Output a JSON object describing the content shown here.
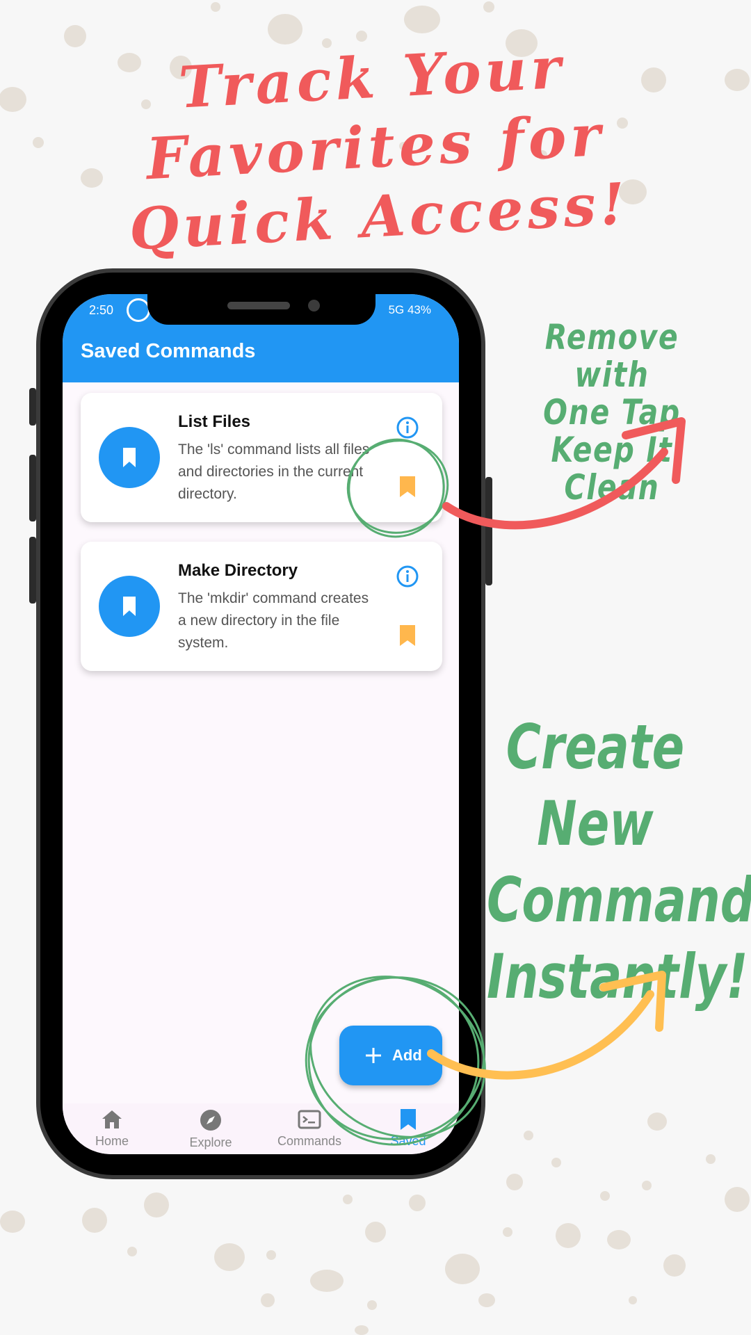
{
  "headline": {
    "line1": "Track Your",
    "line2": "Favorites for",
    "line3": "Quick Access!"
  },
  "callouts": {
    "top_line1": "Remove with",
    "top_line2": "One Tap Keep It",
    "top_line3": "Clean",
    "bottom_line1": "Create New",
    "bottom_line2": "Commands",
    "bottom_line3": "Instantly!"
  },
  "status_bar": {
    "time": "2:50",
    "right": "5G 43%"
  },
  "app_bar": {
    "title": "Saved Commands"
  },
  "cards": [
    {
      "title": "List Files",
      "description": "The 'ls' command lists all files and directories in the current directory.",
      "icon": "bookmark-icon"
    },
    {
      "title": "Make Directory",
      "description": "The 'mkdir' command creates a new directory in the file system.",
      "icon": "bookmark-icon"
    }
  ],
  "fab": {
    "label": "Add",
    "icon": "plus-icon"
  },
  "nav": [
    {
      "label": "Home",
      "icon": "home-icon"
    },
    {
      "label": "Explore",
      "icon": "compass-icon"
    },
    {
      "label": "Commands",
      "icon": "terminal-icon"
    },
    {
      "label": "Saved",
      "icon": "bookmark-icon",
      "active": true
    }
  ],
  "colors": {
    "primary": "#2196f3",
    "headline": "#f05a5b",
    "callout": "#57ad72",
    "arrow_red": "#f05a5b",
    "arrow_yellow": "#ffbf52",
    "bookmark": "#ffb74d"
  }
}
